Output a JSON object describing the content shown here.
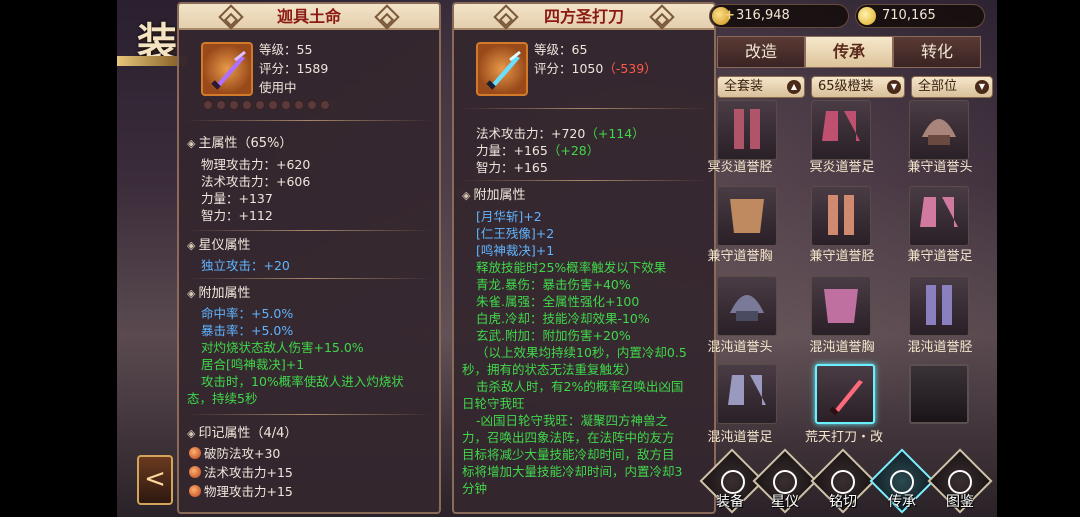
{
  "scene": {
    "title": "装"
  },
  "resources": {
    "gold": "316,948",
    "ingot": "710,165"
  },
  "left_item": {
    "name": "迦具土命",
    "level": "等级：55",
    "score": "评分：1589",
    "status": "使用中",
    "main_attr_title": "主属性（65%）",
    "main_attrs": [
      "物理攻击力：+620",
      "法术攻击力：+606",
      "力量：+137",
      "智力：+112"
    ],
    "star_title": "星仪属性",
    "star_attr": "独立攻击：+20",
    "extra_title": "附加属性",
    "extra_attrs": [
      "命中率：+5.0%",
      "暴击率：+5.0%",
      "对灼烧状态敌人伤害+15.0%",
      "居合[鸣神裁决]+1",
      "攻击时，10%概率使敌人进入灼烧状",
      "态，持续5秒"
    ],
    "seal_title": "印记属性（4/4）",
    "seal_attrs": [
      "破防法攻+30",
      "法术攻击力+15",
      "物理攻击力+15"
    ]
  },
  "right_item": {
    "name": "四方圣打刀",
    "level": "等级：65",
    "score": "评分：1050",
    "score_diff": "（-539）",
    "attr_magic": "法术攻击力：+720",
    "attr_magic_diff": "（+114）",
    "attr_str": "力量：+165",
    "attr_str_diff": "（+28）",
    "attr_int": "智力：+165",
    "extra_title": "附加属性",
    "extra_attrs": [
      "[月华斩]+2",
      "[仁王残像]+2",
      "[鸣神裁决]+1",
      "释放技能时25%概率触发以下效果",
      "青龙.暴伤：暴击伤害+40%",
      "朱雀.属强：全属性强化+100",
      "白虎.冷却：技能冷却效果-10%",
      "玄武.附加：附加伤害+20%",
      "（以上效果均持续10秒，内置冷却0.5",
      "秒，拥有的状态无法重复触发）",
      "击杀敌人时，有2%的概率召唤出凶国",
      "日轮守我旺",
      "-凶国日轮守我旺：凝聚四方神兽之",
      "力，召唤出四象法阵，在法阵中的友方",
      "目标将减少大量技能冷却时间，敌方目",
      "标将增加大量技能冷却时间，内置冷却3",
      "分钟"
    ]
  },
  "tabs": [
    "改造",
    "传承",
    "转化"
  ],
  "active_tab": "传承",
  "filters": [
    "全套装",
    "65级橙装",
    "全部位"
  ],
  "grid": [
    "冥炎道誉胫",
    "冥炎道誉足",
    "兼守道誉头",
    "兼守道誉胸",
    "兼守道誉胫",
    "兼守道誉足",
    "混沌道誉头",
    "混沌道誉胸",
    "混沌道誉胫",
    "混沌道誉足",
    "荒天打刀・改",
    ""
  ],
  "nav": [
    "装备",
    "星仪",
    "铭切",
    "传承",
    "图鉴"
  ],
  "colors": {
    "accent": "#6af0ff",
    "title_red": "#8a1a12",
    "attr_blue": "#5fb4ff",
    "attr_green": "#3fd84a",
    "diff_red": "#ff5a4a"
  }
}
